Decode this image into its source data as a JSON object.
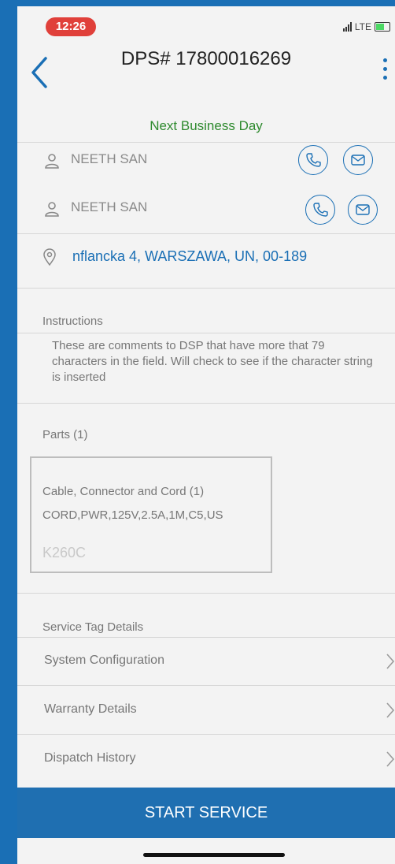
{
  "status_bar": {
    "time": "12:26",
    "network": "LTE"
  },
  "header": {
    "title": "DPS# 17800016269"
  },
  "priority_label": "Next Business Day",
  "contacts": [
    {
      "name": "NEETH SAN"
    },
    {
      "name": "NEETH SAN"
    }
  ],
  "address": "nflancka 4, WARSZAWA, UN, 00-189",
  "instructions": {
    "label": "Instructions",
    "text": "These are comments to DSP that have more that 79 characters in the field. Will check to see if the character string is inserted"
  },
  "parts": {
    "label": "Parts (1)",
    "items": [
      {
        "category": "Cable, Connector and Cord (1)",
        "description": "CORD,PWR,125V,2.5A,1M,C5,US",
        "code": "K260C"
      }
    ]
  },
  "service_tag": {
    "label": "Service Tag Details",
    "items": [
      {
        "label": "System Configuration"
      },
      {
        "label": "Warranty Details"
      },
      {
        "label": "Dispatch History"
      }
    ]
  },
  "footer": {
    "start_label": "START SERVICE"
  },
  "colors": {
    "accent": "#1a6fb5",
    "priority": "#2e8a2e",
    "time_badge": "#e0403a"
  },
  "icons": [
    "back-chevron-icon",
    "kebab-menu-icon",
    "person-icon",
    "phone-icon",
    "mail-icon",
    "location-pin-icon",
    "chevron-right-icon"
  ]
}
